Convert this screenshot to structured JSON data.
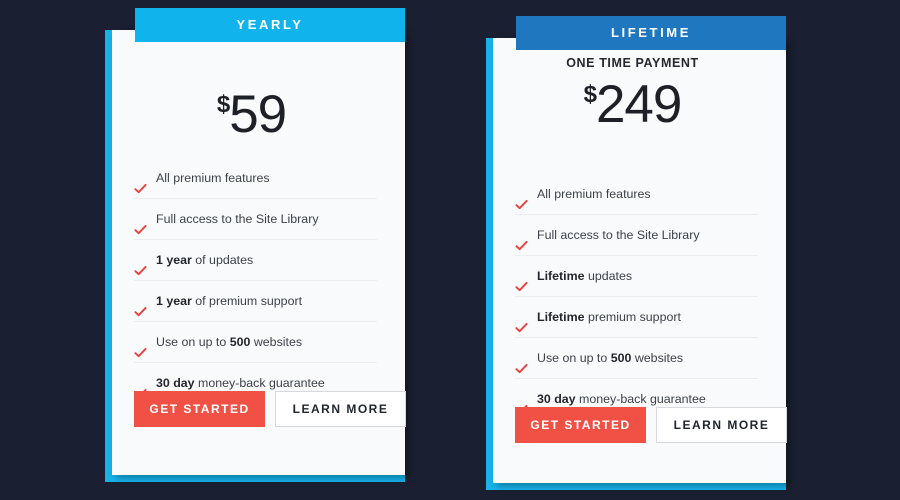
{
  "theme": {
    "background": "#1a2031",
    "accent_cyan": "#17b2e9",
    "card_background": "#f8fafc",
    "primary_button": "#f15045",
    "check_color": "#e8433c",
    "text_color": "#3c4148"
  },
  "plans": [
    {
      "id": "yearly",
      "ribbon_label": "YEARLY",
      "ribbon_color": "#11b3ed",
      "subtitle": "",
      "currency": "$",
      "amount": "59",
      "features": [
        {
          "strong": "",
          "text": "All premium features"
        },
        {
          "strong": "",
          "text": "Full access to the Site Library"
        },
        {
          "strong": "1 year",
          "text": " of updates"
        },
        {
          "strong": "1 year",
          "text": " of premium support"
        },
        {
          "strong": "",
          "text": "Use on up to ",
          "strong_mid": "500",
          "text_after": " websites"
        },
        {
          "strong": "30 day",
          "text": " money-back guarantee"
        }
      ],
      "primary_button": "GET STARTED",
      "secondary_button": "LEARN MORE"
    },
    {
      "id": "lifetime",
      "ribbon_label": "LIFETIME",
      "ribbon_color": "#1f78bf",
      "subtitle": "ONE TIME PAYMENT",
      "currency": "$",
      "amount": "249",
      "features": [
        {
          "strong": "",
          "text": "All premium features"
        },
        {
          "strong": "",
          "text": "Full access to the Site Library"
        },
        {
          "strong": "Lifetime",
          "text": " updates"
        },
        {
          "strong": "Lifetime",
          "text": " premium support"
        },
        {
          "strong": "",
          "text": "Use on up to ",
          "strong_mid": "500",
          "text_after": " websites"
        },
        {
          "strong": "30 day",
          "text": " money-back guarantee"
        }
      ],
      "primary_button": "GET STARTED",
      "secondary_button": "LEARN MORE"
    }
  ]
}
